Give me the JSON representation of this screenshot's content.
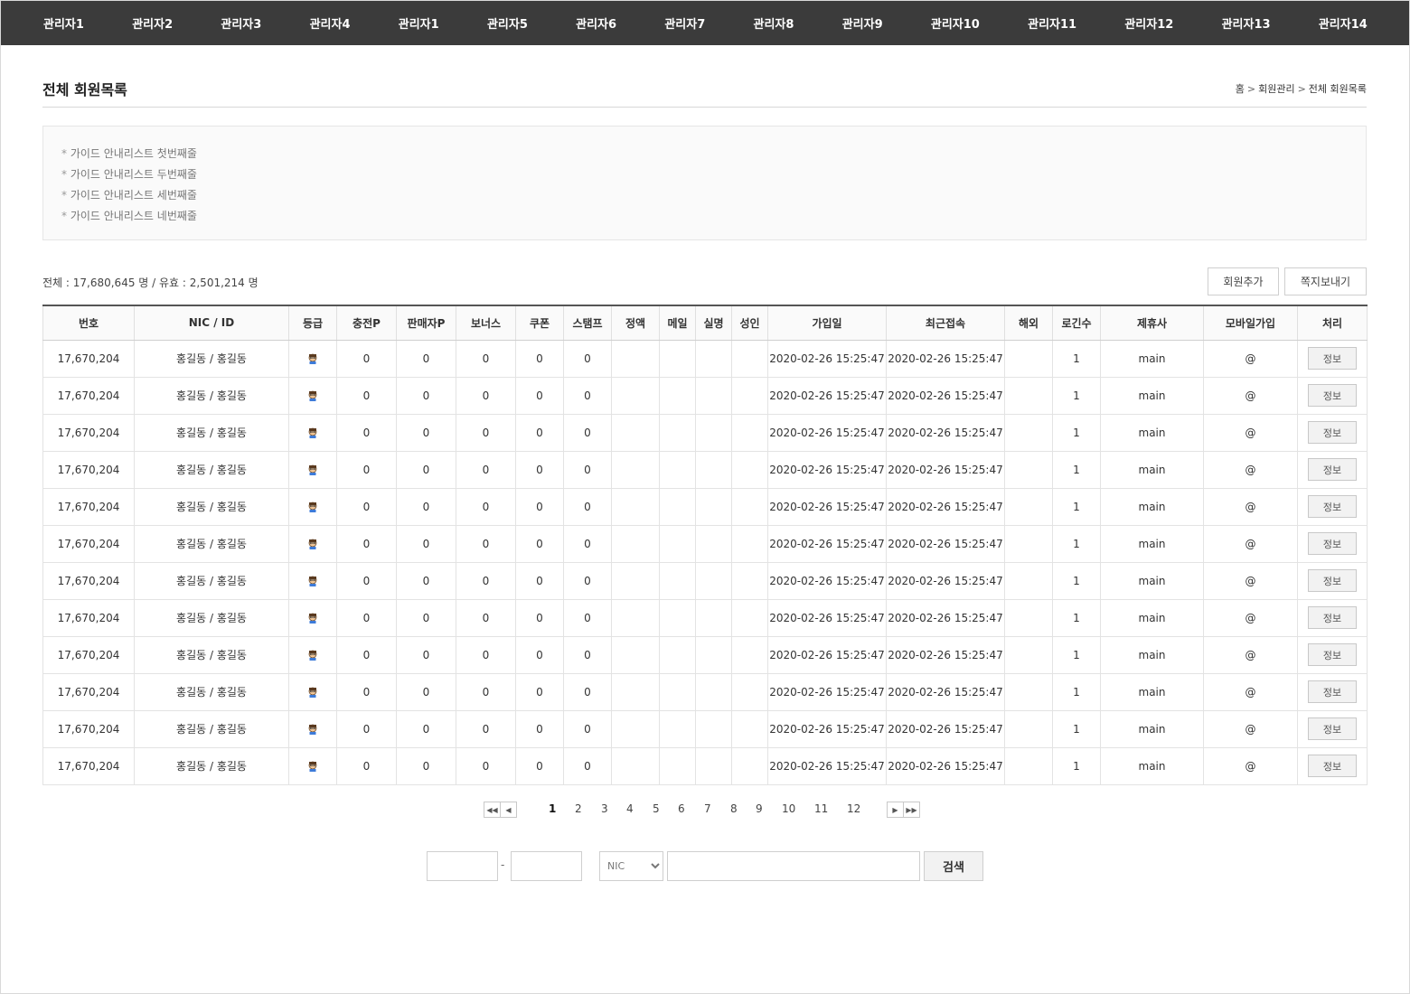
{
  "nav": {
    "items": [
      "관리자1",
      "관리자2",
      "관리자3",
      "관리자4",
      "관리자1",
      "관리자5",
      "관리자6",
      "관리자7",
      "관리자8",
      "관리자9",
      "관리자10",
      "관리자11",
      "관리자12",
      "관리자13",
      "관리자14"
    ]
  },
  "header": {
    "title": "전체 회원목록",
    "breadcrumb": [
      "홈",
      "회원관리",
      "전체 회원목록"
    ]
  },
  "guide": {
    "lines": [
      "가이드 안내리스트 첫번째줄",
      "가이드 안내리스트 두번째줄",
      "가이드 안내리스트 세번째줄",
      "가이드 안내리스트 네번째줄"
    ]
  },
  "summary": {
    "text": "전체 : 17,680,645 명 / 유효 : 2,501,214 명"
  },
  "buttons": {
    "add_member": "회원추가",
    "send_message": "쪽지보내기",
    "info": "정보",
    "search": "검색"
  },
  "table": {
    "columns": [
      "번호",
      "NIC / ID",
      "등급",
      "충전P",
      "판매자P",
      "보너스",
      "쿠폰",
      "스탬프",
      "정액",
      "메일",
      "실명",
      "성인",
      "가입일",
      "최근접속",
      "해외",
      "로긴수",
      "제휴사",
      "모바일가입",
      "처리"
    ],
    "rows": [
      [
        "17,670,204",
        "홍길동 / 홍길동",
        "grade-icon",
        "0",
        "0",
        "0",
        "0",
        "0",
        "",
        "",
        "",
        "",
        "2020-02-26 15:25:47",
        "2020-02-26 15:25:47",
        "",
        "1",
        "main",
        "@"
      ],
      [
        "17,670,204",
        "홍길동 / 홍길동",
        "grade-icon",
        "0",
        "0",
        "0",
        "0",
        "0",
        "",
        "",
        "",
        "",
        "2020-02-26 15:25:47",
        "2020-02-26 15:25:47",
        "",
        "1",
        "main",
        "@"
      ],
      [
        "17,670,204",
        "홍길동 / 홍길동",
        "grade-icon",
        "0",
        "0",
        "0",
        "0",
        "0",
        "",
        "",
        "",
        "",
        "2020-02-26 15:25:47",
        "2020-02-26 15:25:47",
        "",
        "1",
        "main",
        "@"
      ],
      [
        "17,670,204",
        "홍길동 / 홍길동",
        "grade-icon",
        "0",
        "0",
        "0",
        "0",
        "0",
        "",
        "",
        "",
        "",
        "2020-02-26 15:25:47",
        "2020-02-26 15:25:47",
        "",
        "1",
        "main",
        "@"
      ],
      [
        "17,670,204",
        "홍길동 / 홍길동",
        "grade-icon",
        "0",
        "0",
        "0",
        "0",
        "0",
        "",
        "",
        "",
        "",
        "2020-02-26 15:25:47",
        "2020-02-26 15:25:47",
        "",
        "1",
        "main",
        "@"
      ],
      [
        "17,670,204",
        "홍길동 / 홍길동",
        "grade-icon",
        "0",
        "0",
        "0",
        "0",
        "0",
        "",
        "",
        "",
        "",
        "2020-02-26 15:25:47",
        "2020-02-26 15:25:47",
        "",
        "1",
        "main",
        "@"
      ],
      [
        "17,670,204",
        "홍길동 / 홍길동",
        "grade-icon",
        "0",
        "0",
        "0",
        "0",
        "0",
        "",
        "",
        "",
        "",
        "2020-02-26 15:25:47",
        "2020-02-26 15:25:47",
        "",
        "1",
        "main",
        "@"
      ],
      [
        "17,670,204",
        "홍길동 / 홍길동",
        "grade-icon",
        "0",
        "0",
        "0",
        "0",
        "0",
        "",
        "",
        "",
        "",
        "2020-02-26 15:25:47",
        "2020-02-26 15:25:47",
        "",
        "1",
        "main",
        "@"
      ],
      [
        "17,670,204",
        "홍길동 / 홍길동",
        "grade-icon",
        "0",
        "0",
        "0",
        "0",
        "0",
        "",
        "",
        "",
        "",
        "2020-02-26 15:25:47",
        "2020-02-26 15:25:47",
        "",
        "1",
        "main",
        "@"
      ],
      [
        "17,670,204",
        "홍길동 / 홍길동",
        "grade-icon",
        "0",
        "0",
        "0",
        "0",
        "0",
        "",
        "",
        "",
        "",
        "2020-02-26 15:25:47",
        "2020-02-26 15:25:47",
        "",
        "1",
        "main",
        "@"
      ],
      [
        "17,670,204",
        "홍길동 / 홍길동",
        "grade-icon",
        "0",
        "0",
        "0",
        "0",
        "0",
        "",
        "",
        "",
        "",
        "2020-02-26 15:25:47",
        "2020-02-26 15:25:47",
        "",
        "1",
        "main",
        "@"
      ],
      [
        "17,670,204",
        "홍길동 / 홍길동",
        "grade-icon",
        "0",
        "0",
        "0",
        "0",
        "0",
        "",
        "",
        "",
        "",
        "2020-02-26 15:25:47",
        "2020-02-26 15:25:47",
        "",
        "1",
        "main",
        "@"
      ]
    ]
  },
  "pagination": {
    "pages": [
      "1",
      "2",
      "3",
      "4",
      "5",
      "6",
      "7",
      "8",
      "9",
      "10",
      "11",
      "12"
    ],
    "current": "1"
  },
  "search": {
    "select_value": "NIC",
    "date_from": "",
    "date_to": "",
    "keyword": "",
    "dash": "-"
  }
}
